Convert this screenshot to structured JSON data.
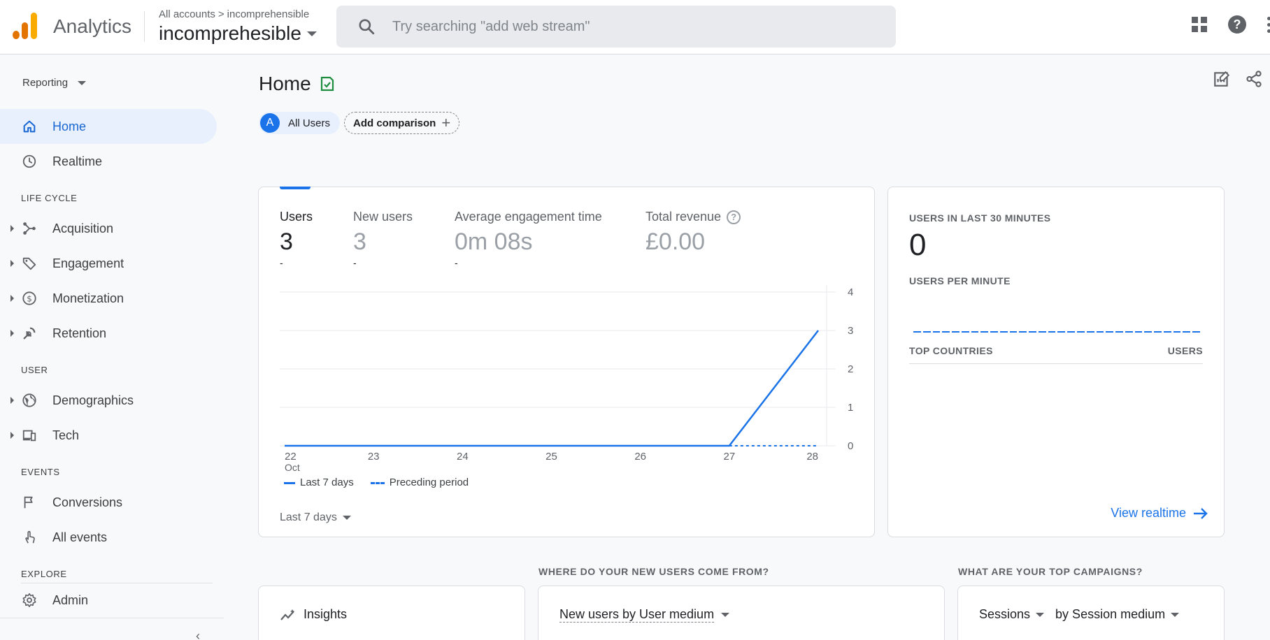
{
  "app": {
    "brand": "Analytics"
  },
  "breadcrumb": {
    "all_accounts": "All accounts",
    "separator": ">",
    "account": "incomprehensible"
  },
  "property": {
    "name": "incomprehesible"
  },
  "search": {
    "placeholder": "Try searching \"add web stream\""
  },
  "sidebar": {
    "reporting_label": "Reporting",
    "items": [
      {
        "label": "Home"
      },
      {
        "label": "Realtime"
      },
      {
        "label": "Acquisition"
      },
      {
        "label": "Engagement"
      },
      {
        "label": "Monetization"
      },
      {
        "label": "Retention"
      },
      {
        "label": "Demographics"
      },
      {
        "label": "Tech"
      },
      {
        "label": "Conversions"
      },
      {
        "label": "All events"
      },
      {
        "label": "Admin"
      }
    ],
    "sections": {
      "life_cycle": "LIFE CYCLE",
      "user": "USER",
      "events": "EVENTS",
      "explore": "EXPLORE"
    },
    "collapse_glyph": "‹"
  },
  "page": {
    "title": "Home",
    "chip_all_users": {
      "avatar": "A",
      "label": "All Users"
    },
    "chip_add_comparison": "Add comparison"
  },
  "metrics": [
    {
      "label": "Users",
      "value": "3",
      "delta": "-"
    },
    {
      "label": "New users",
      "value": "3",
      "delta": "-"
    },
    {
      "label": "Average engagement time",
      "value": "0m 08s",
      "delta": "-"
    },
    {
      "label": "Total revenue",
      "value": "£0.00",
      "delta": ""
    }
  ],
  "chart_data": {
    "type": "line",
    "x": [
      "22",
      "23",
      "24",
      "25",
      "26",
      "27",
      "28"
    ],
    "x_sublabel": {
      "first": "Oct"
    },
    "y_ticks": [
      "4",
      "3",
      "2",
      "1",
      "0"
    ],
    "ylim": [
      0,
      4
    ],
    "series": [
      {
        "name": "Last 7 days",
        "values": [
          0,
          0,
          0,
          0,
          0,
          0,
          3
        ],
        "style": "solid"
      },
      {
        "name": "Preceding period",
        "values": [
          null,
          null,
          null,
          null,
          null,
          0,
          0
        ],
        "style": "dashed"
      }
    ],
    "grid": true,
    "legend_position": "bottom-left",
    "color": "#1a73e8"
  },
  "range_selector": "Last 7 days",
  "realtime": {
    "users_label": "USERS IN LAST 30 MINUTES",
    "users_value": "0",
    "per_minute_label": "USERS PER MINUTE",
    "top_countries": "TOP COUNTRIES",
    "users_col": "USERS",
    "link": "View realtime"
  },
  "bottom": {
    "where_head": "WHERE DO YOUR NEW USERS COME FROM?",
    "campaigns_head": "WHAT ARE YOUR TOP CAMPAIGNS?",
    "insights": "Insights",
    "new_users_by": "New users by User medium",
    "sessions": "Sessions",
    "by_session_medium": "by Session medium"
  },
  "colors": {
    "accent": "#1a73e8",
    "active_bg": "#e8f0fe",
    "logo_orange": "#f9ab00",
    "logo_dark": "#e37400",
    "check_green": "#1e8e3e"
  }
}
